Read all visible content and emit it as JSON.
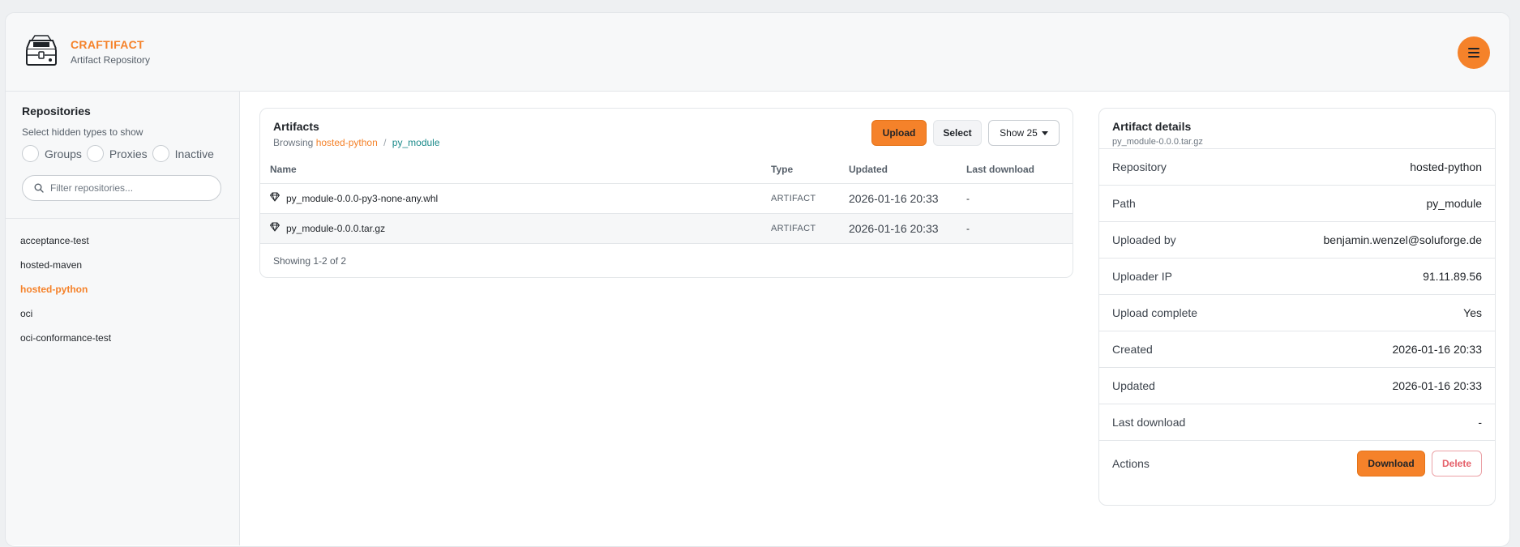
{
  "brand": {
    "title": "CRAFTIFACT",
    "subtitle": "Artifact Repository"
  },
  "icons": {
    "logo": "treasure-chest-icon",
    "menu": "hamburger-menu-icon",
    "search": "search-icon",
    "artifact": "gem-icon",
    "caret": "caret-down-icon"
  },
  "colors": {
    "accent": "#f5822a",
    "path": "#1a8a8a",
    "danger": "#e5606a"
  },
  "sidebar": {
    "title": "Repositories",
    "hint": "Select hidden types to show",
    "filters": [
      {
        "label": "Groups",
        "checked": false
      },
      {
        "label": "Proxies",
        "checked": false
      },
      {
        "label": "Inactive",
        "checked": false
      }
    ],
    "search_placeholder": "Filter repositories...",
    "repos": [
      {
        "label": "acceptance-test",
        "active": false
      },
      {
        "label": "hosted-maven",
        "active": false
      },
      {
        "label": "hosted-python",
        "active": true
      },
      {
        "label": "oci",
        "active": false
      },
      {
        "label": "oci-conformance-test",
        "active": false
      }
    ]
  },
  "artifacts": {
    "title": "Artifacts",
    "browsing_label": "Browsing",
    "breadcrumb_repo": "hosted-python",
    "breadcrumb_sep": "/",
    "breadcrumb_path": "py_module",
    "upload_label": "Upload",
    "select_label": "Select",
    "show_label": "Show 25",
    "columns": [
      "Name",
      "Type",
      "Updated",
      "Last download"
    ],
    "rows": [
      {
        "name": "py_module-0.0.0-py3-none-any.whl",
        "type": "ARTIFACT",
        "updated": "2026-01-16 20:33",
        "last_download": "-"
      },
      {
        "name": "py_module-0.0.0.tar.gz",
        "type": "ARTIFACT",
        "updated": "2026-01-16 20:33",
        "last_download": "-"
      }
    ],
    "showing": "Showing 1-2 of 2"
  },
  "details": {
    "title": "Artifact details",
    "subtitle": "py_module-0.0.0.tar.gz",
    "rows": [
      {
        "label": "Repository",
        "value": "hosted-python"
      },
      {
        "label": "Path",
        "value": "py_module"
      },
      {
        "label": "Uploaded by",
        "value": "benjamin.wenzel@soluforge.de"
      },
      {
        "label": "Uploader IP",
        "value": "91.11.89.56"
      },
      {
        "label": "Upload complete",
        "value": "Yes"
      },
      {
        "label": "Created",
        "value": "2026-01-16 20:33"
      },
      {
        "label": "Updated",
        "value": "2026-01-16 20:33"
      },
      {
        "label": "Last download",
        "value": "-"
      }
    ],
    "actions_label": "Actions",
    "download_label": "Download",
    "delete_label": "Delete"
  }
}
